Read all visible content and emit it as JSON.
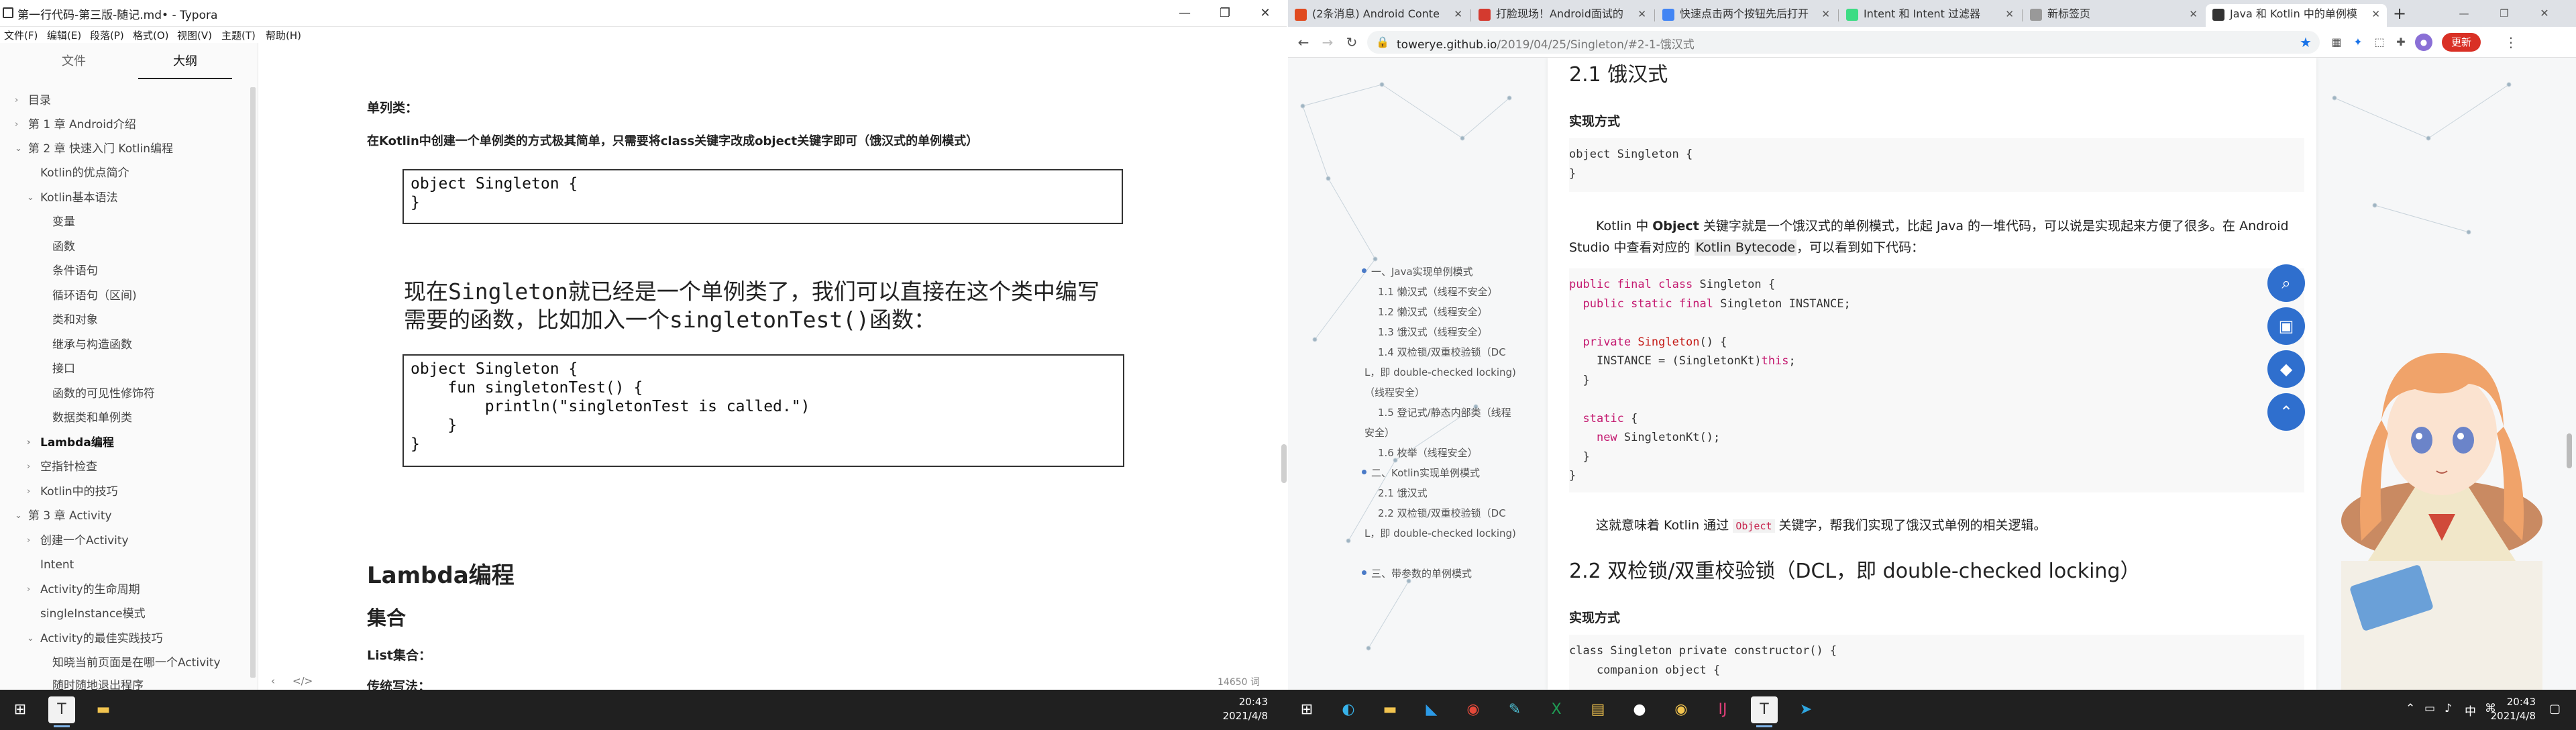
{
  "typora": {
    "window_title": "第一行代码-第三版-随记.md• - Typora",
    "controls": {
      "minimize": "—",
      "maximize": "❐",
      "close": "✕"
    },
    "menu": [
      "文件(F)",
      "编辑(E)",
      "段落(P)",
      "格式(O)",
      "视图(V)",
      "主题(T)",
      "帮助(H)"
    ],
    "sidebar_tabs": [
      "文件",
      "大纲"
    ],
    "outline": [
      {
        "label": "目录",
        "caret": "›"
      },
      {
        "label": "第 1 章 Android介绍",
        "caret": "›"
      },
      {
        "label": "第 2 章 快速入门 Kotlin编程",
        "caret": "⌄"
      },
      {
        "label": "Kotlin的优点简介",
        "caret": ""
      },
      {
        "label": "Kotlin基本语法",
        "caret": "⌄"
      },
      {
        "label": "变量",
        "caret": ""
      },
      {
        "label": "函数",
        "caret": ""
      },
      {
        "label": "条件语句",
        "caret": ""
      },
      {
        "label": "循环语句（区间)",
        "caret": ""
      },
      {
        "label": "类和对象",
        "caret": ""
      },
      {
        "label": "继承与构造函数",
        "caret": ""
      },
      {
        "label": "接口",
        "caret": ""
      },
      {
        "label": "函数的可见性修饰符",
        "caret": ""
      },
      {
        "label": "数据类和单例类",
        "caret": ""
      },
      {
        "label": "Lambda编程",
        "caret": "›"
      },
      {
        "label": "空指针检查",
        "caret": "›"
      },
      {
        "label": "Kotlin中的技巧",
        "caret": "›"
      },
      {
        "label": "第 3 章 Activity",
        "caret": "⌄"
      },
      {
        "label": "创建一个Activity",
        "caret": "›"
      },
      {
        "label": "Intent",
        "caret": ""
      },
      {
        "label": "Activity的生命周期",
        "caret": "›"
      },
      {
        "label": "singleInstance模式",
        "caret": ""
      },
      {
        "label": "Activity的最佳实践技巧",
        "caret": "⌄"
      },
      {
        "label": "知晓当前页面是在哪一个Activity",
        "caret": ""
      },
      {
        "label": "随时随地退出程序",
        "caret": ""
      }
    ],
    "editor": {
      "singleton_heading": "单列类：",
      "singleton_desc": "在Kotlin中创建一个单例类的方式极其简单，只需要将class关键字改成object关键字即可（饿汉式的单例模式）",
      "code1": "object Singleton {\n}",
      "para_part1": "现在",
      "para_code1": "Singleton",
      "para_part2": "就已经是一个单例类了，我们可以直接在这个类中编写",
      "para_part3": "需要的函数，比如加入一个",
      "para_code2": "singletonTest()",
      "para_part4": "函数：",
      "code2": "object Singleton {\n    fun singletonTest() {\n        println(\"singletonTest is called.\")\n    }\n}",
      "h_lambda": "Lambda编程",
      "h_collection": "集合",
      "list_collection": "List集合：",
      "traditional": "传统写法：",
      "word_count": "14650 词",
      "nav_back": "‹",
      "nav_code": "</>"
    }
  },
  "chrome": {
    "tabs": [
      {
        "title": "(2条消息) Android Conte",
        "favicon_color": "#e04a1f"
      },
      {
        "title": "打脸现场！Android面试的",
        "favicon_color": "#d43a2f"
      },
      {
        "title": "快速点击两个按钮先后打开",
        "favicon_color": "#4285f4"
      },
      {
        "title": "Intent 和 Intent 过滤器",
        "favicon_color": "#3ddc84"
      },
      {
        "title": "新标签页",
        "favicon_color": "#999999"
      },
      {
        "title": "Java 和 Kotlin 中的单例模",
        "favicon_color": "#333333"
      }
    ],
    "new_tab": "+",
    "url_host": "toweryе.github.io",
    "url_path": "/2019/04/25/Singleton/#2-1-饿汉式",
    "update_button": "更新",
    "article": {
      "h_21": "2.1 饿汉式",
      "impl_label": "实现方式",
      "code_object": "object Singleton {\n}",
      "para1_a": "Kotlin 中 ",
      "para1_obj": "Object",
      "para1_b": " 关键字就是一个饿汉式的单例模式，比起 Java 的一堆代码，可以说是实现起来方便了很多。在 Android",
      "para1_c": "Studio 中查看对应的 ",
      "para1_hl": "Kotlin Bytecode",
      "para1_d": "，可以看到如下代码：",
      "para2_a": "这就意味着 Kotlin 通过 ",
      "para2_code": "Object",
      "para2_b": " 关键字，帮我们实现了饿汉式单例的相关逻辑。",
      "h_22": "2.2 双检锁/双重校验锁（DCL，即 double-checked locking）",
      "impl_label2": "实现方式",
      "code_dcl": "class Singleton private constructor() {\n    companion object {"
    },
    "toc": [
      {
        "label": "一、Java实现单例模式",
        "level": 1
      },
      {
        "label": "1.1 懒汉式（线程不安全）",
        "level": 2
      },
      {
        "label": "1.2 懒汉式（线程安全）",
        "level": 2
      },
      {
        "label": "1.3 饿汉式（线程安全）",
        "level": 2
      },
      {
        "label": "1.4 双检锁/双重校验锁（DC",
        "level": 2
      },
      {
        "label": "L，即 double-checked locking)",
        "level": 3
      },
      {
        "label": "（线程安全）",
        "level": 3
      },
      {
        "label": "1.5 登记式/静态内部类（线程",
        "level": 2
      },
      {
        "label": "安全）",
        "level": 3
      },
      {
        "label": "1.6 枚举（线程安全）",
        "level": 2
      },
      {
        "label": "二、Kotlin实现单例模式",
        "level": 1
      },
      {
        "label": "2.1 饿汉式",
        "level": 2
      },
      {
        "label": "2.2 双检锁/双重校验锁（DC",
        "level": 2
      },
      {
        "label": "L，即 double-checked locking)",
        "level": 3
      },
      {
        "label": "三、带参数的单例模式",
        "level": 1
      }
    ]
  },
  "taskbar": {
    "left_clock": {
      "time": "20:43",
      "date": "2021/4/8"
    },
    "right_clock": {
      "time": "20:43",
      "date": "2021/4/8"
    },
    "ime": "中",
    "apps": [
      "start",
      "edge",
      "explorer",
      "vscode",
      "chrome",
      "notepad",
      "excel",
      "folder",
      "github",
      "chrome-canary",
      "intellij",
      "typora",
      "telegram"
    ]
  }
}
